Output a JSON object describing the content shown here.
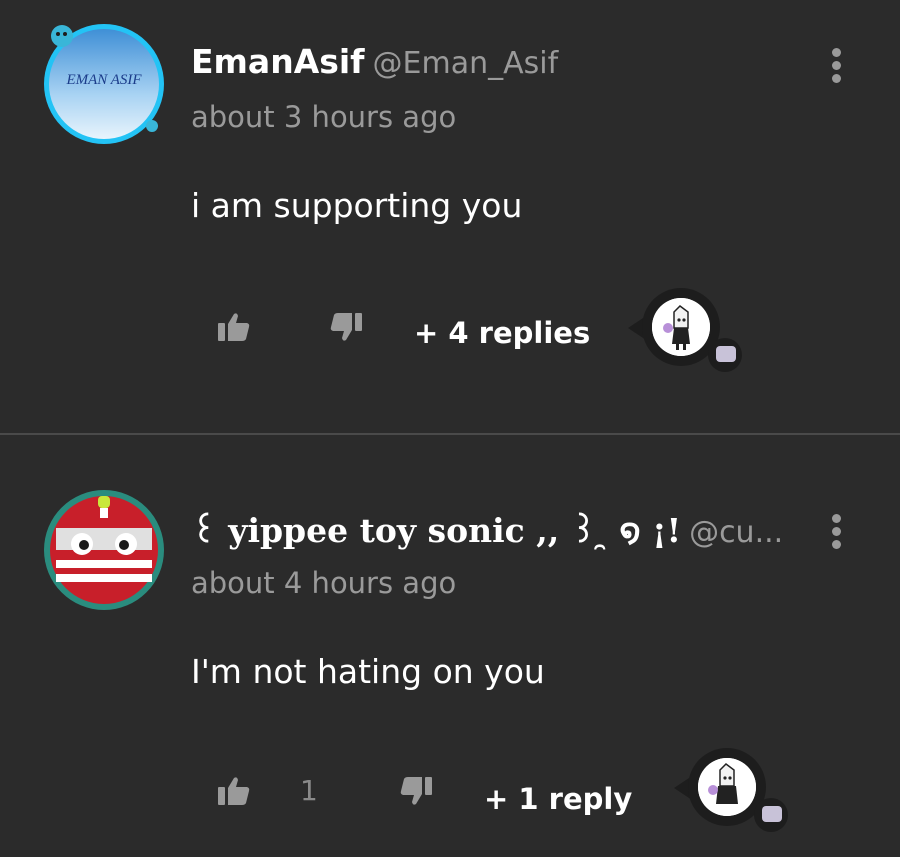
{
  "comments": [
    {
      "username": "EmanAsif",
      "handle": "@Eman_Asif",
      "time": "about 3 hours ago",
      "text": "i am supporting you",
      "avatar_text": "EMAN ASIF",
      "like_count": "",
      "replies_label": "+ 4 replies"
    },
    {
      "username": "꒰ yippee toy sonic ,, ꒱ ̯ ໑ ¡!",
      "handle": "@cu...",
      "time": "about 4 hours ago",
      "text": "I'm not hating on you",
      "like_count": "1",
      "replies_label": "+ 1 reply"
    }
  ],
  "icons": {
    "like": "thumbs-up-icon",
    "dislike": "thumbs-down-icon",
    "more": "more-vertical-icon",
    "reply": "chat-bubble-icon"
  },
  "colors": {
    "background": "#2b2b2b",
    "secondary_text": "#9a9a9a",
    "divider": "#4a4a4a"
  }
}
